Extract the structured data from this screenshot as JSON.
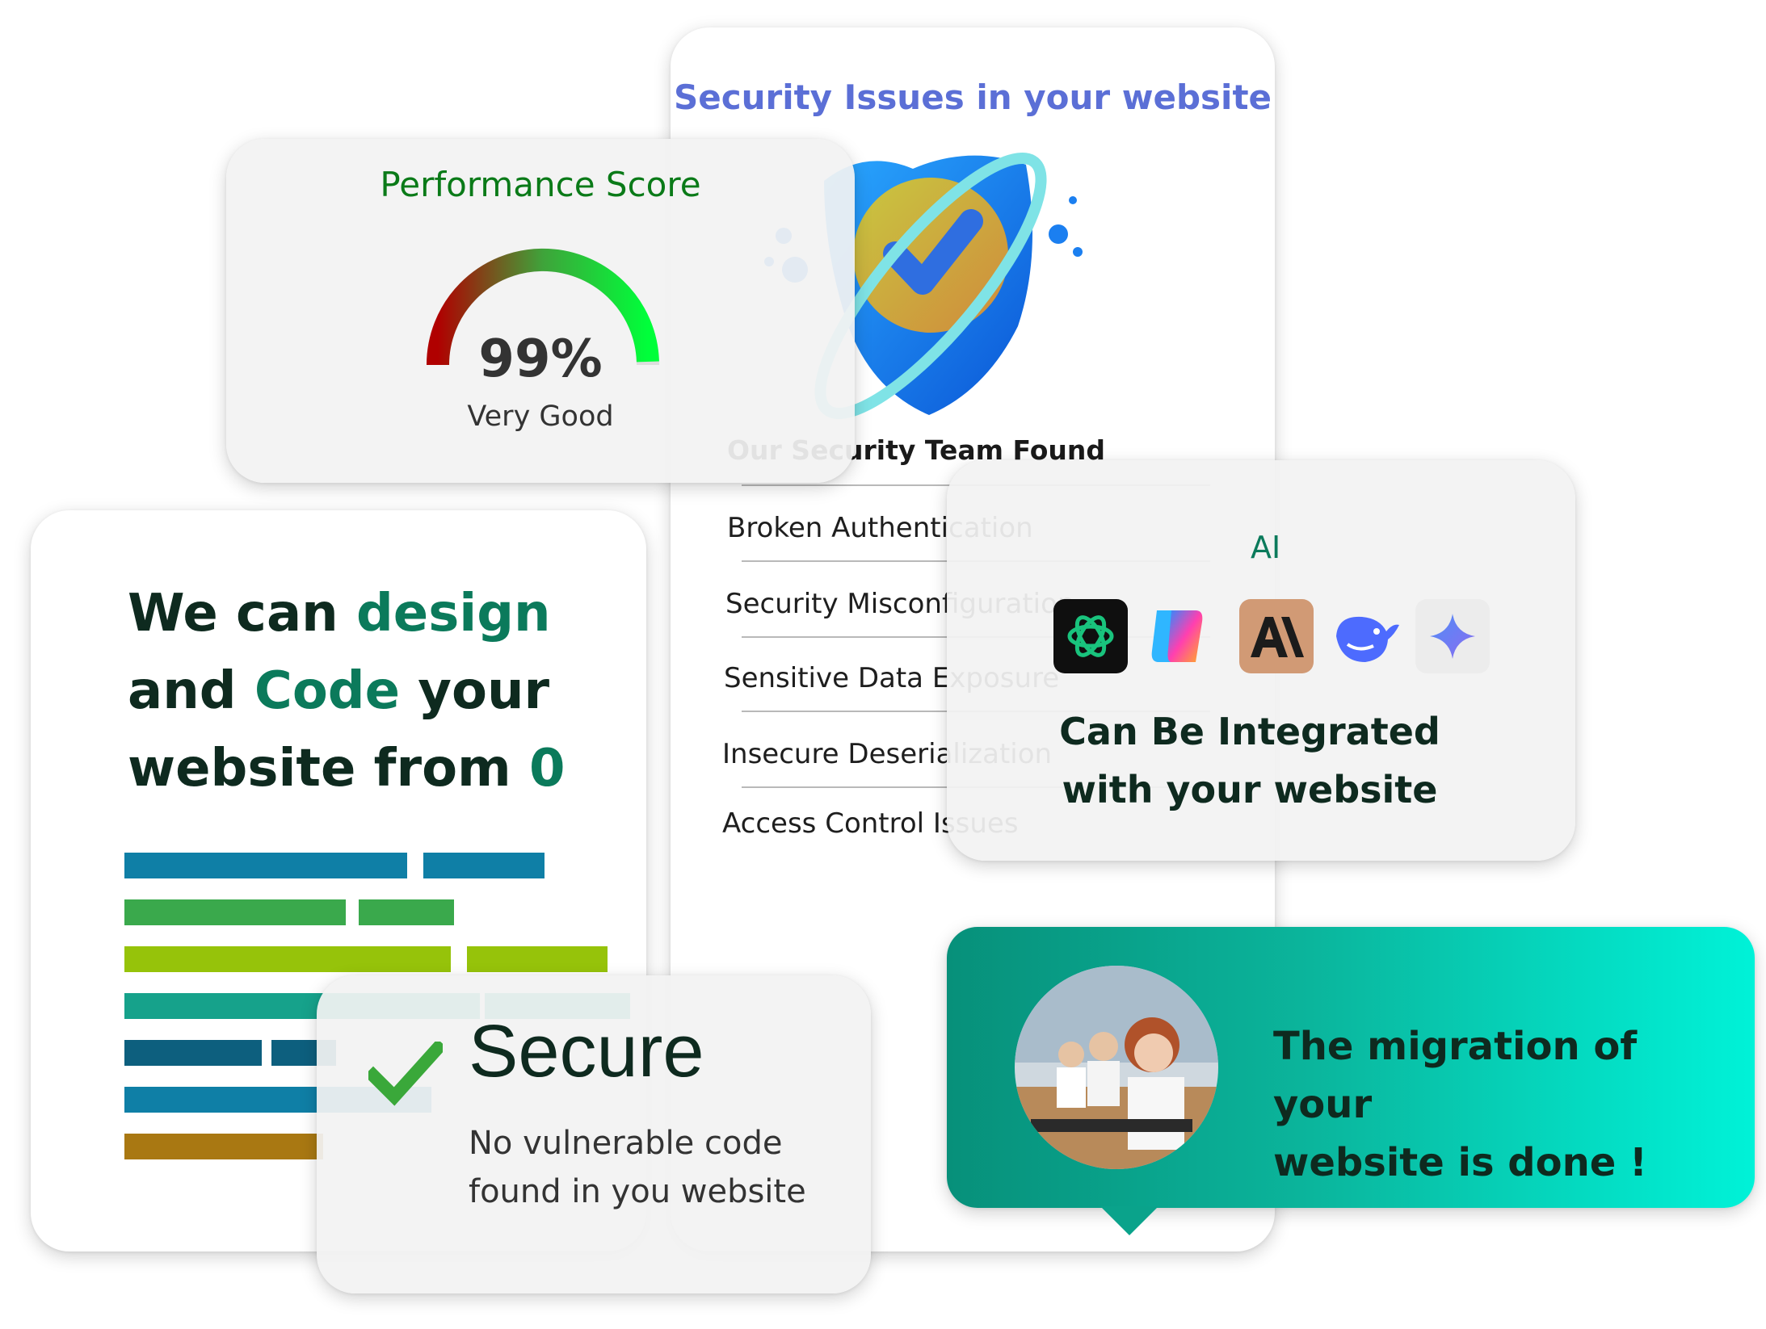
{
  "security": {
    "title": "Security Issues in your website",
    "team_found": "Our Security Team Found",
    "issues": [
      "Broken Authentication",
      "Security Misconfiguration",
      "Sensitive Data Exposure",
      "Insecure Deserialization",
      "Access Control Issues"
    ]
  },
  "performance": {
    "title": "Performance Score",
    "value": "99%",
    "score_fraction": 0.99,
    "label": "Very Good"
  },
  "design": {
    "line1_a": "We can ",
    "line1_b": "design",
    "line2_a": "and ",
    "line2_b": "Code",
    "line2_c": " your",
    "line3_a": "website from ",
    "line3_b": "0"
  },
  "ai": {
    "label": "AI",
    "logos": [
      "chatgpt-logo-icon",
      "copilot-logo-icon",
      "anthropic-logo-icon",
      "deepseek-logo-icon",
      "gemini-logo-icon"
    ],
    "title_line1": "Can Be Integrated",
    "title_line2": "with your website"
  },
  "secure": {
    "title": "Secure",
    "desc_line1": "No vulnerable code",
    "desc_line2": "found in you website"
  },
  "migration": {
    "text_line1": "The migration of your",
    "text_line2": "website is done !"
  },
  "colors": {
    "security_title": "#5b6fd6",
    "performance_title": "#0a7a18",
    "accent": "#0b7a5b",
    "migration_start": "#07907a",
    "migration_end": "#00f2d8"
  }
}
